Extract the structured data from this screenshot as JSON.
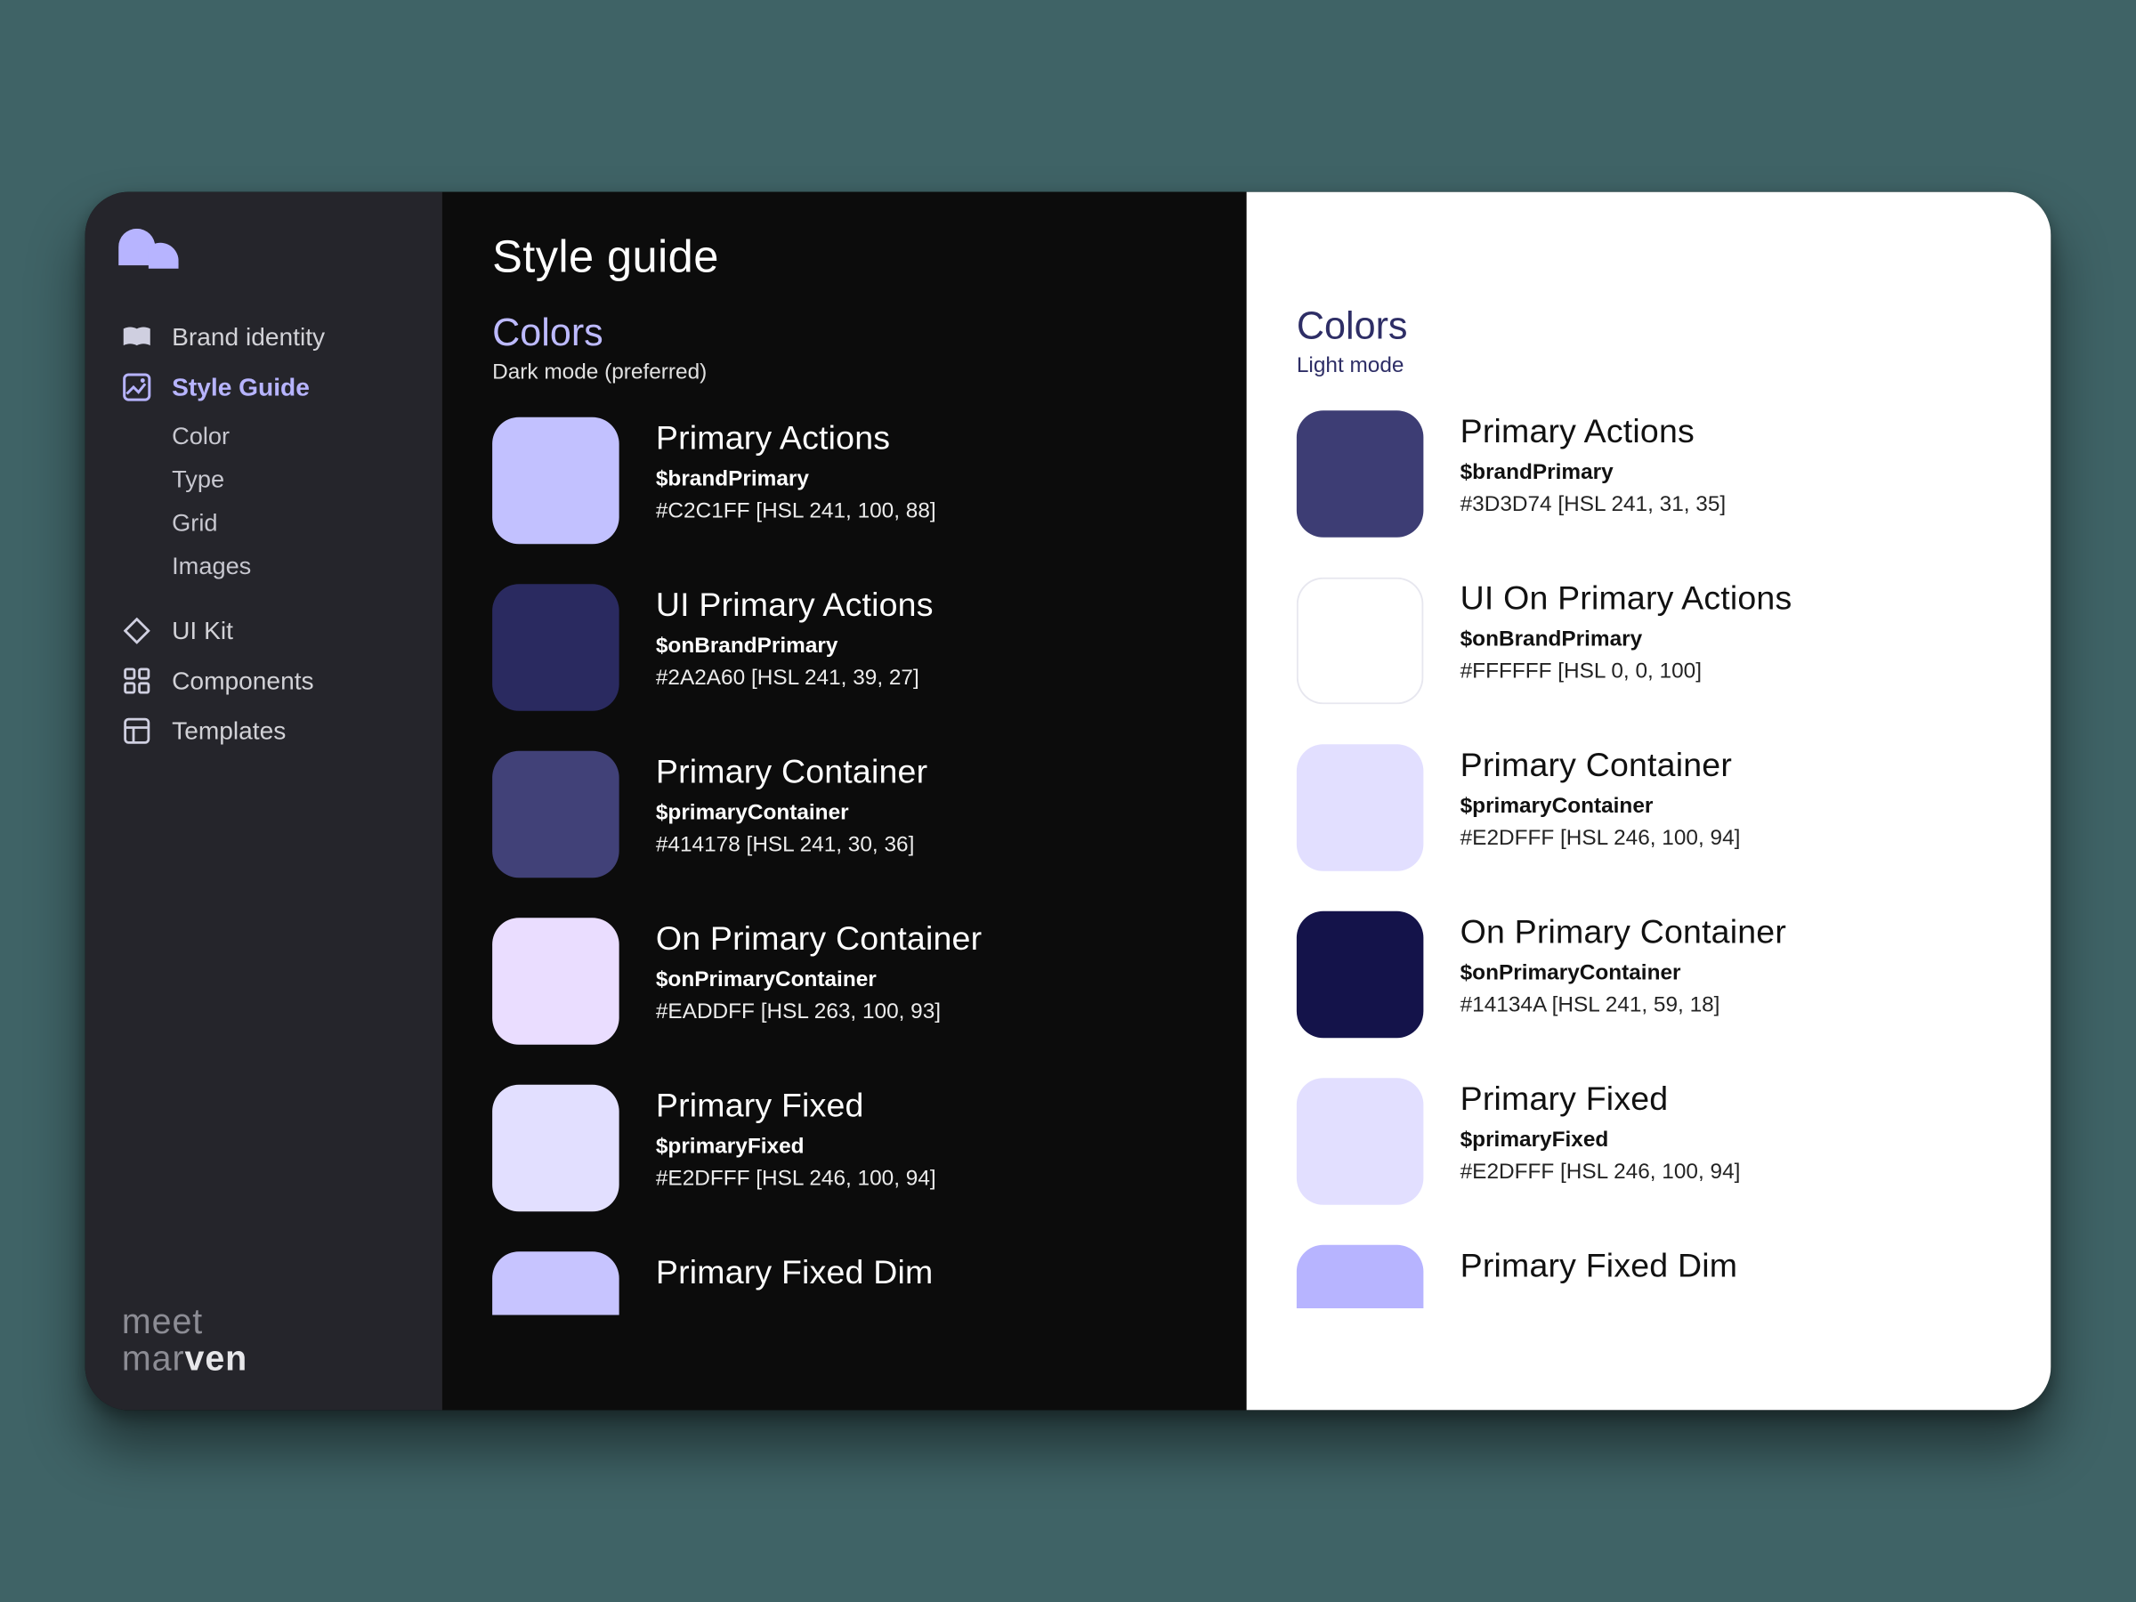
{
  "brand": {
    "line1": "meet",
    "line2_a": "mar",
    "line2_b": "ven"
  },
  "page": {
    "title": "Style guide"
  },
  "sidebar": {
    "items": [
      {
        "label": "Brand identity",
        "active": false
      },
      {
        "label": "Style Guide",
        "active": true,
        "children": [
          {
            "label": "Color"
          },
          {
            "label": "Type"
          },
          {
            "label": "Grid"
          },
          {
            "label": "Images"
          }
        ]
      },
      {
        "label": "UI Kit",
        "active": false
      },
      {
        "label": "Components",
        "active": false
      },
      {
        "label": "Templates",
        "active": false
      }
    ]
  },
  "dark": {
    "heading": "Colors",
    "subheading": "Dark mode (preferred)",
    "swatches": [
      {
        "name": "Primary Actions",
        "token": "$brandPrimary",
        "code": "#C2C1FF [HSL 241, 100, 88]",
        "hex": "#C2C1FF"
      },
      {
        "name": "UI Primary Actions",
        "token": "$onBrandPrimary",
        "code": "#2A2A60 [HSL 241, 39, 27]",
        "hex": "#2A2A60"
      },
      {
        "name": "Primary Container",
        "token": "$primaryContainer",
        "code": "#414178 [HSL 241, 30, 36]",
        "hex": "#414178"
      },
      {
        "name": "On Primary Container",
        "token": "$onPrimaryContainer",
        "code": "#EADDFF [HSL 263, 100, 93]",
        "hex": "#EADDFF"
      },
      {
        "name": "Primary Fixed",
        "token": "$primaryFixed",
        "code": "#E2DFFF [HSL 246, 100, 94]",
        "hex": "#E2DFFF"
      },
      {
        "name": "Primary Fixed Dim",
        "token": "",
        "code": "",
        "hex": "#C7C4FF",
        "cutoff": true
      }
    ]
  },
  "light": {
    "heading": "Colors",
    "subheading": "Light mode",
    "swatches": [
      {
        "name": "Primary Actions",
        "token": "$brandPrimary",
        "code": "#3D3D74 [HSL 241, 31, 35]",
        "hex": "#3D3D74"
      },
      {
        "name": "UI On Primary Actions",
        "token": "$onBrandPrimary",
        "code": "#FFFFFF [HSL 0, 0, 100]",
        "hex": "#FFFFFF",
        "bordered": true
      },
      {
        "name": "Primary Container",
        "token": "$primaryContainer",
        "code": "#E2DFFF [HSL 246, 100, 94]",
        "hex": "#E2DFFF"
      },
      {
        "name": "On Primary Container",
        "token": "$onPrimaryContainer",
        "code": "#14134A [HSL 241, 59, 18]",
        "hex": "#14134A"
      },
      {
        "name": "Primary Fixed",
        "token": "$primaryFixed",
        "code": "#E2DFFF [HSL 246, 100, 94]",
        "hex": "#E2DFFF"
      },
      {
        "name": "Primary Fixed Dim",
        "token": "",
        "code": "",
        "hex": "#B7B4FF",
        "cutoff": true
      }
    ]
  }
}
